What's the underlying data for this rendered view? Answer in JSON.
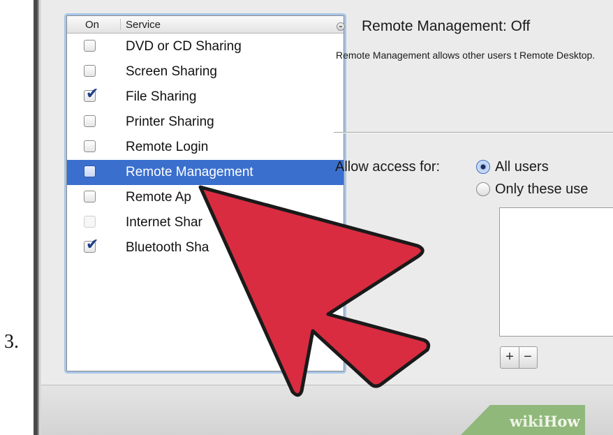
{
  "step_label": "3.",
  "services_table": {
    "columns": {
      "on": "On",
      "service": "Service"
    },
    "rows": [
      {
        "label": "DVD or CD Sharing",
        "checked": false
      },
      {
        "label": "Screen Sharing",
        "checked": false
      },
      {
        "label": "File Sharing",
        "checked": true
      },
      {
        "label": "Printer Sharing",
        "checked": false
      },
      {
        "label": "Remote Login",
        "checked": false
      },
      {
        "label": "Remote Management",
        "checked": false,
        "selected": true
      },
      {
        "label": "Remote Ap      nts",
        "checked": false
      },
      {
        "label": "Internet Shar",
        "checked": false
      },
      {
        "label": "Bluetooth Sha",
        "checked": true
      }
    ]
  },
  "detail": {
    "status_title": "Remote Management: Off",
    "description": "Remote Management allows other users t Remote Desktop.",
    "access_label": "Allow access for:",
    "options": {
      "all_users": "All users",
      "only_these": "Only these use"
    },
    "selected_option": "all_users",
    "add_symbol": "+",
    "remove_symbol": "−"
  },
  "watermark": {
    "wiki": "wiki",
    "how": "How"
  },
  "colors": {
    "selection": "#3a6fce",
    "focus_ring": "#a8c6e8",
    "arrow_fill": "#d92c40",
    "badge_green": "#8fb87a"
  },
  "icons": {
    "checkmark": "✔",
    "status": "status-off-icon",
    "pointer": "red-pointer-arrow"
  }
}
